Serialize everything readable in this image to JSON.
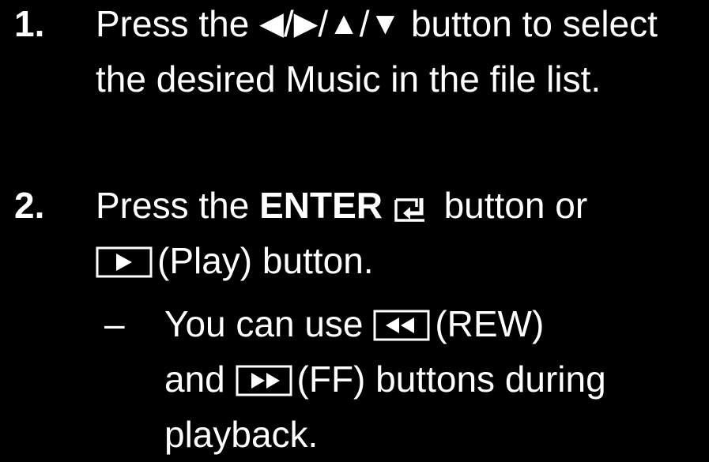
{
  "steps": [
    {
      "number": "1.",
      "text_before": "Press the",
      "arrow_left": "◀",
      "sep1": "/",
      "arrow_right": "▶",
      "sep2": "/",
      "arrow_up": "▲",
      "sep3": "/",
      "arrow_down": "▼",
      "text_after": "button to select the desired Music in the file list."
    },
    {
      "number": "2.",
      "text_before": "Press the",
      "enter_label": "ENTER",
      "text_after": "button or",
      "play_label": "(Play) button."
    }
  ],
  "note": {
    "dash": "–",
    "text_before": "You can use",
    "rew_label": "(REW)",
    "middle": "and",
    "ff_label": "(FF) buttons during playback."
  },
  "icons": {
    "enter": "enter-icon",
    "play": "play-icon",
    "rewind": "rewind-icon",
    "fast_forward": "fast-forward-icon"
  },
  "colors": {
    "background": "#000000",
    "text": "#ffffff"
  }
}
